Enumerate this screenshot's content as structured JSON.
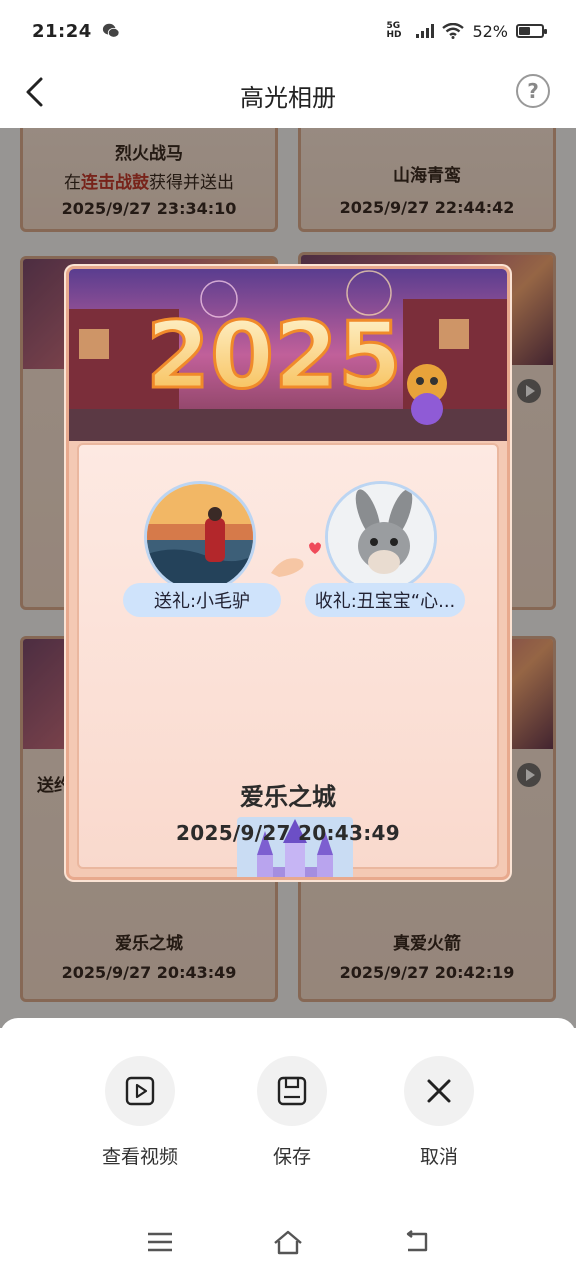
{
  "status_bar": {
    "time": "21:24",
    "network": "5G HD",
    "battery": "52%",
    "battery_level": 0.52
  },
  "header": {
    "title": "高光相册",
    "help_label": "?"
  },
  "album": {
    "cards": [
      {
        "name": "烈火战马",
        "desc_prefix": "在",
        "desc_highlight": "连击战鼓",
        "desc_suffix": "获得并送出",
        "date": "2025/9/27 23:34:10"
      },
      {
        "name": "山海青鸾",
        "date": "2025/9/27 22:44:42"
      },
      {
        "name": "爱乐之城",
        "date": "2025/9/27 20:43:49"
      },
      {
        "name": "真爱火箭",
        "date": "2025/9/27 20:42:19"
      }
    ],
    "partial_text": "送约"
  },
  "popup": {
    "banner_text": "2025",
    "sender_label": "送礼:小毛驴",
    "receiver_label": "收礼:丑宝宝“心...",
    "gift_name": "爱乐之城",
    "gift_date": "2025/9/27 20:43:49"
  },
  "actions": {
    "watch_video": "查看视频",
    "save": "保存",
    "cancel": "取消"
  },
  "colors": {
    "highlight": "#c0392b",
    "pill_bg": "#cfe3fb",
    "card_border": "#d9a989"
  },
  "icons": [
    "back-arrow-icon",
    "help-icon",
    "play-icon",
    "video-icon",
    "save-icon",
    "close-icon",
    "menu-icon",
    "home-icon",
    "back-icon"
  ]
}
